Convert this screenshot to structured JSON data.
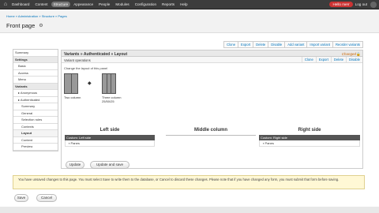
{
  "toolbar": {
    "items": [
      "Dashboard",
      "Content",
      "Structure",
      "Appearance",
      "People",
      "Modules",
      "Configuration",
      "Reports",
      "Help"
    ],
    "active_index": 2,
    "user": "Hello merr",
    "logout": "Log out"
  },
  "breadcrumb": "Home » Administration » Structure » Pages",
  "page_title": "Front page",
  "top_actions": [
    "Clone",
    "Export",
    "Delete",
    "Disable",
    "Add variant",
    "Import variant",
    "Reorder variants"
  ],
  "sidebar": [
    {
      "label": "Summary",
      "level": 0
    },
    {
      "label": "Settings",
      "level": 0,
      "header": true
    },
    {
      "label": "Basic",
      "level": 1
    },
    {
      "label": "Access",
      "level": 1
    },
    {
      "label": "Menu",
      "level": 1
    },
    {
      "label": "Variants",
      "level": 0,
      "header": true
    },
    {
      "label": "▸ Anonymous",
      "level": 1
    },
    {
      "label": "▸ Authenticated",
      "level": 1
    },
    {
      "label": "Summary",
      "level": 2
    },
    {
      "label": "General",
      "level": 2
    },
    {
      "label": "Selection rules",
      "level": 2
    },
    {
      "label": "Contexts",
      "level": 2
    },
    {
      "label": "Layout",
      "level": 2,
      "current": true
    },
    {
      "label": "Content",
      "level": 2
    },
    {
      "label": "Preview",
      "level": 2
    }
  ],
  "variant": {
    "title": "Variants » Authenticated » Layout",
    "changed": "Changed",
    "ops_label": "Variant operations",
    "ops_actions": [
      "Clone",
      "Export",
      "Delete",
      "Disable"
    ],
    "layout_note": "Change the layout of this panel",
    "layouts": [
      {
        "caption": "Two column",
        "columns": 2
      },
      {
        "caption": "Three column 25/50/25",
        "columns": 3
      }
    ],
    "regions": [
      {
        "title": "Left side",
        "bar": "Custom: Left side",
        "pane": "Panes"
      },
      {
        "title": "Middle column",
        "bar": "",
        "pane": ""
      },
      {
        "title": "Right side",
        "bar": "Custom: Right side",
        "pane": "Panes"
      }
    ],
    "buttons": {
      "update": "Update",
      "update_save": "Update and save"
    }
  },
  "notice": "You have unsaved changes to this page. You must select Save to write them to the database, or Cancel to discard these changes. Please note that if you have changed any form, you must submit that form before saving.",
  "footer": {
    "save": "Save",
    "cancel": "Cancel"
  }
}
